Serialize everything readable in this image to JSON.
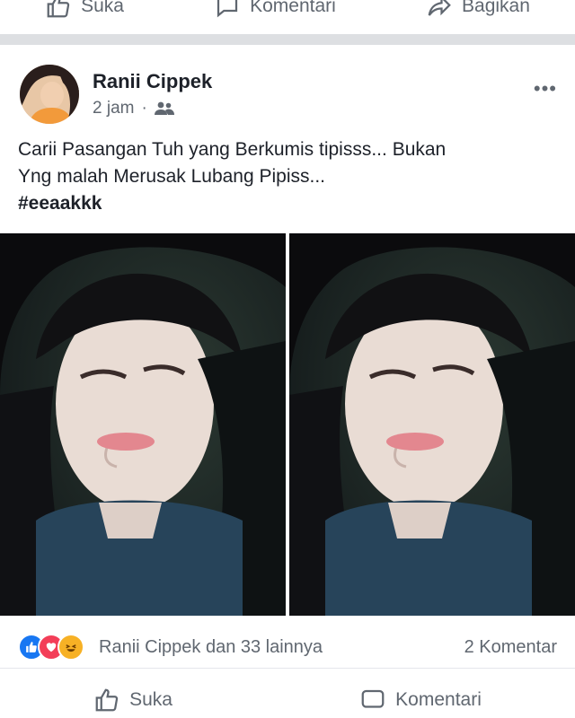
{
  "top_actions": {
    "like": "Suka",
    "comment": "Komentari",
    "share": "Bagikan"
  },
  "post": {
    "author": "Ranii Cippek",
    "time": "2 jam",
    "separator": "·",
    "text_line1": "Carii Pasangan Tuh yang Berkumis tipisss... Bukan",
    "text_line2": "Yng malah Merusak Lubang Pipiss...",
    "hashtag": "#eeaakkk",
    "more": "•••"
  },
  "reactions": {
    "summary": "Ranii Cippek dan 33 lainnya",
    "comments": "2 Komentar",
    "icons": [
      "like-icon",
      "love-icon",
      "haha-icon"
    ],
    "colors": {
      "like": "#1877f2",
      "love": "#f33e58",
      "haha": "#f7b125"
    }
  },
  "bottom_actions": {
    "like": "Suka",
    "comment": "Komentari"
  }
}
